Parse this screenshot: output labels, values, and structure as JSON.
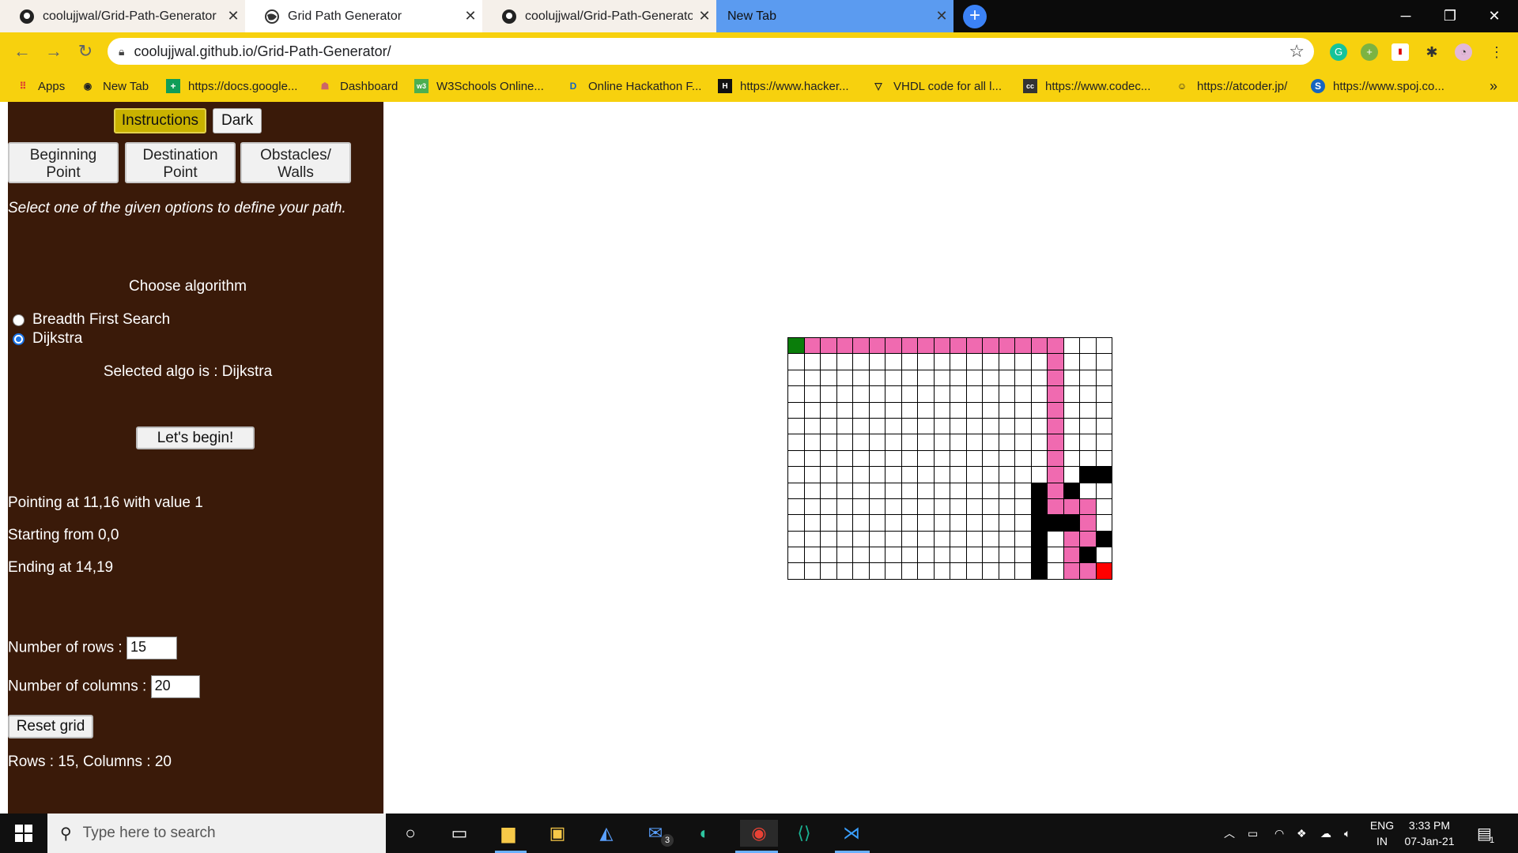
{
  "browser": {
    "tabs": [
      {
        "title": "coolujjwal/Grid-Path-Generator",
        "icon": "github-icon"
      },
      {
        "title": "Grid Path Generator",
        "icon": "globe-icon"
      },
      {
        "title": "coolujjwal/Grid-Path-Generator",
        "icon": "github-icon"
      },
      {
        "title": "New Tab",
        "icon": ""
      }
    ],
    "url": "coolujjwal.github.io/Grid-Path-Generator/",
    "bookmarks": [
      "Apps",
      "New Tab",
      "https://docs.google...",
      "Dashboard",
      "W3Schools Online...",
      "Online Hackathon F...",
      "https://www.hacker...",
      "VHDL code for all l...",
      "https://www.codec...",
      "https://atcoder.jp/",
      "https://www.spoj.co..."
    ],
    "more_bookmarks": "»"
  },
  "sidebar": {
    "instructions_label": "Instructions",
    "dark_label": "Dark",
    "beginning_line1": "Beginning",
    "beginning_line2": "Point",
    "destination_line1": "Destination",
    "destination_line2": "Point",
    "obstacles_line1": "Obstacles/",
    "obstacles_line2": "Walls",
    "hint": "Select one of the given options to define your path.",
    "choose_algorithm": "Choose algorithm",
    "algorithms": [
      {
        "label": "Breadth First Search",
        "checked": false
      },
      {
        "label": "Dijkstra",
        "checked": true
      }
    ],
    "selected_algo": "Selected algo is : Dijkstra",
    "begin_label": "Let's begin!",
    "pointing": "Pointing at 11,16 with value 1",
    "starting": "Starting from 0,0",
    "ending": "Ending at 14,19",
    "rows_label": "Number of rows :",
    "rows_value": "15",
    "cols_label": "Number of columns :",
    "cols_value": "20",
    "reset_label": "Reset grid",
    "summary": "Rows : 15, Columns : 20"
  },
  "grid": {
    "rows": 15,
    "cols": 20,
    "start": [
      0,
      0
    ],
    "end": [
      14,
      19
    ],
    "walls": [
      [
        8,
        18
      ],
      [
        8,
        19
      ],
      [
        9,
        15
      ],
      [
        9,
        17
      ],
      [
        10,
        15
      ],
      [
        11,
        15
      ],
      [
        11,
        16
      ],
      [
        11,
        17
      ],
      [
        12,
        15
      ],
      [
        12,
        19
      ],
      [
        13,
        15
      ],
      [
        13,
        18
      ],
      [
        14,
        15
      ]
    ],
    "path": [
      [
        0,
        1
      ],
      [
        0,
        2
      ],
      [
        0,
        3
      ],
      [
        0,
        4
      ],
      [
        0,
        5
      ],
      [
        0,
        6
      ],
      [
        0,
        7
      ],
      [
        0,
        8
      ],
      [
        0,
        9
      ],
      [
        0,
        10
      ],
      [
        0,
        11
      ],
      [
        0,
        12
      ],
      [
        0,
        13
      ],
      [
        0,
        14
      ],
      [
        0,
        15
      ],
      [
        0,
        16
      ],
      [
        1,
        16
      ],
      [
        2,
        16
      ],
      [
        3,
        16
      ],
      [
        4,
        16
      ],
      [
        5,
        16
      ],
      [
        6,
        16
      ],
      [
        7,
        16
      ],
      [
        8,
        16
      ],
      [
        9,
        16
      ],
      [
        10,
        16
      ],
      [
        10,
        17
      ],
      [
        10,
        18
      ],
      [
        11,
        18
      ],
      [
        12,
        17
      ],
      [
        12,
        18
      ],
      [
        13,
        17
      ],
      [
        14,
        17
      ],
      [
        14,
        18
      ]
    ],
    "colors": {
      "start": "#0a7d0a",
      "end": "#ff0000",
      "wall": "#000000",
      "path": "#f06ab0",
      "empty": "#ffffff"
    }
  },
  "taskbar": {
    "search_placeholder": "Type here to search",
    "mail_badge": "3",
    "lang_line1": "ENG",
    "lang_line2": "IN",
    "time": "3:33 PM",
    "date": "07-Jan-21",
    "notification_count": "1"
  },
  "colors": {
    "toolbar": "#f7d10e",
    "sidebar_bg": "#3a1a09",
    "instructions_btn": "#c9b200"
  }
}
